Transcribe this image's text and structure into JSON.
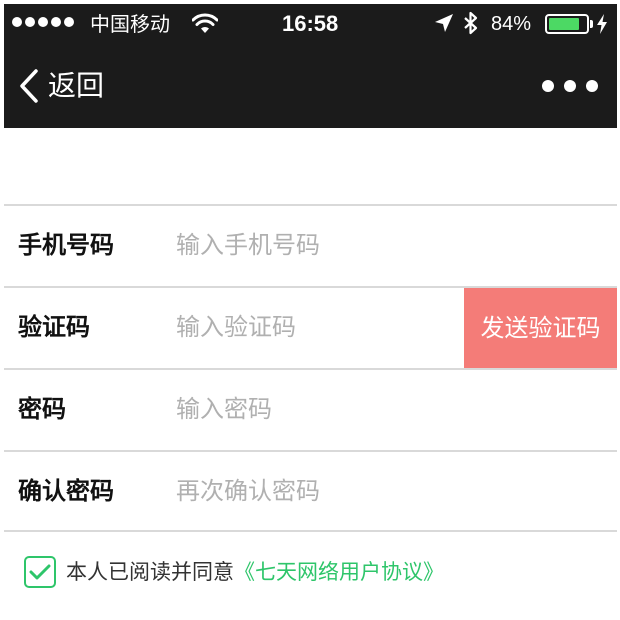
{
  "status_bar": {
    "carrier": "中国移动",
    "time": "16:58",
    "battery_percent_label": "84%",
    "battery_level": 0.84,
    "battery_color": "#4cd964",
    "icons": [
      "signal-dots-icon",
      "wifi-icon",
      "location-arrow-icon",
      "bluetooth-icon",
      "battery-icon",
      "charging-bolt-icon"
    ]
  },
  "nav_bar": {
    "back_label": "返回",
    "back_icon": "chevron-left-icon",
    "more_icon": "more-dots-icon",
    "background": "#1b1b1b"
  },
  "form": {
    "phone": {
      "label": "手机号码",
      "placeholder": "输入手机号码",
      "value": ""
    },
    "code": {
      "label": "验证码",
      "placeholder": "输入验证码",
      "value": "",
      "send_button": "发送验证码",
      "send_button_color": "#f47c78"
    },
    "password": {
      "label": "密码",
      "placeholder": "输入密码",
      "value": ""
    },
    "confirm_password": {
      "label": "确认密码",
      "placeholder": "再次确认密码",
      "value": ""
    }
  },
  "agreement": {
    "checked": true,
    "text": "本人已阅读并同意",
    "link": "《七天网络用户协议》",
    "accent_color": "#2ec56a"
  }
}
